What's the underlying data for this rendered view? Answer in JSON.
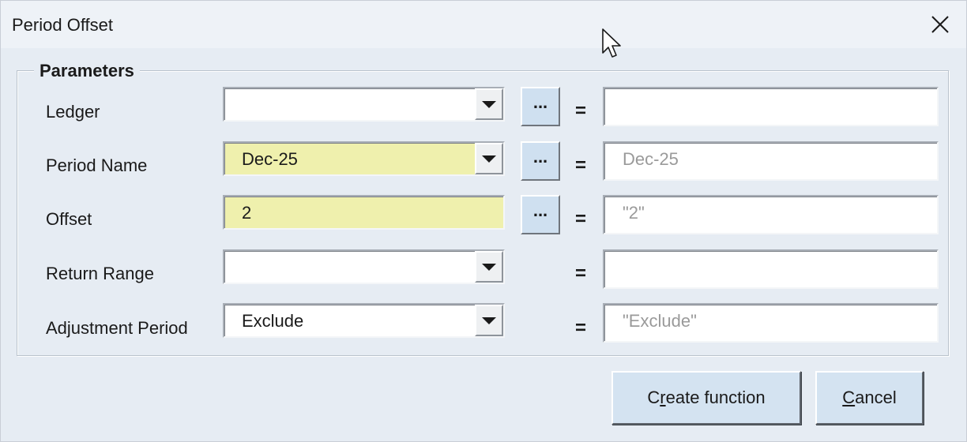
{
  "window": {
    "title": "Period Offset"
  },
  "icons": {
    "close": "close-icon",
    "cursor": "mouse-pointer-icon",
    "dropdown": "chevron-down-icon"
  },
  "group": {
    "legend": "Parameters"
  },
  "fields": [
    {
      "label": "Ledger",
      "value": "",
      "kind": "combo",
      "highlight": false,
      "has_picker": true,
      "result": ""
    },
    {
      "label": "Period Name",
      "value": "Dec-25",
      "kind": "combo",
      "highlight": true,
      "has_picker": true,
      "result": "Dec-25"
    },
    {
      "label": "Offset",
      "value": "2",
      "kind": "text",
      "highlight": true,
      "has_picker": true,
      "result": "\"2\""
    },
    {
      "label": "Return Range",
      "value": "",
      "kind": "combo",
      "highlight": false,
      "has_picker": false,
      "result": ""
    },
    {
      "label": "Adjustment Period",
      "value": "Exclude",
      "kind": "combo",
      "highlight": false,
      "has_picker": false,
      "result": "\"Exclude\""
    }
  ],
  "labels": {
    "picker": "...",
    "equals": "="
  },
  "buttons": {
    "create_pre": "C",
    "create_u": "r",
    "create_post": "eate function",
    "cancel_pre": "",
    "cancel_u": "C",
    "cancel_post": "ancel"
  },
  "colors": {
    "window_bg": "#e6ecf3",
    "required_field": "#eff0ad",
    "button_bg": "#d4e3f1",
    "picker_bg": "#cfe0f0",
    "result_text": "#9a9a9a"
  }
}
